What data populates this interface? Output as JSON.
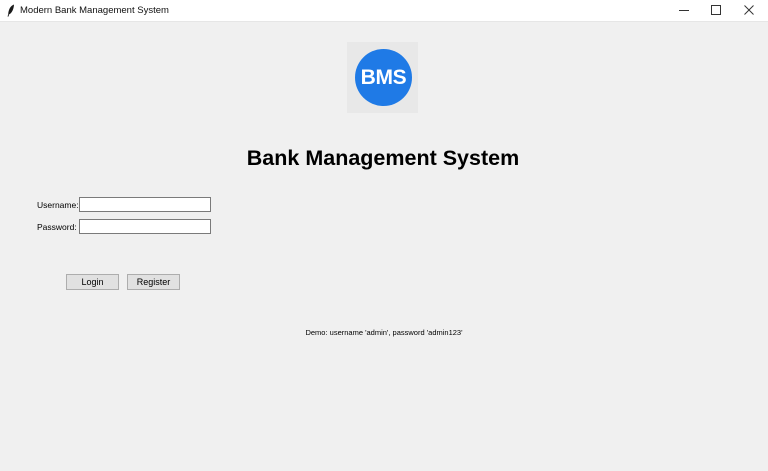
{
  "window": {
    "title": "Modern Bank Management System",
    "icon": "feather-icon",
    "controls": {
      "minimize_icon": "minimize-icon",
      "maximize_icon": "maximize-icon",
      "close_icon": "close-icon"
    }
  },
  "logo": {
    "text": "BMS",
    "color": "#1f7ae6"
  },
  "header": {
    "title": "Bank Management System"
  },
  "form": {
    "username_label": "Username:",
    "username_value": "",
    "password_label": "Password:",
    "password_value": ""
  },
  "buttons": {
    "login_label": "Login",
    "register_label": "Register"
  },
  "footer": {
    "demo_text": "Demo: username 'admin', password 'admin123'"
  }
}
